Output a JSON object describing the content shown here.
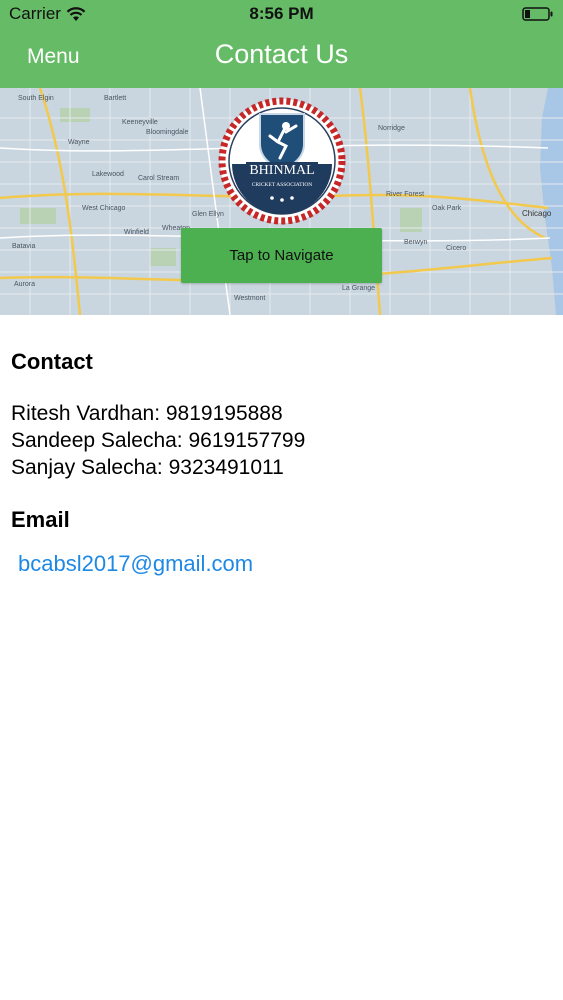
{
  "status_bar": {
    "carrier": "Carrier",
    "time": "8:56 PM"
  },
  "nav": {
    "menu_label": "Menu",
    "title": "Contact Us"
  },
  "map": {
    "places": [
      "South Elgin",
      "Bartlett",
      "Keeneyville",
      "Bloomingdale",
      "Wayne",
      "Carol Stream",
      "Lakewood",
      "Glen Ellyn",
      "Wheaton",
      "West Chicago",
      "Winfield",
      "Batavia",
      "Aurora",
      "Oak Park",
      "Chicago",
      "Cicero",
      "Berwyn",
      "River Forest",
      "Norridge",
      "Westmont",
      "La Grange"
    ],
    "logo_text": "BHINMAL",
    "logo_subtext": "CRICKET ASSOCIATION",
    "navigate_label": "Tap to Navigate"
  },
  "contact": {
    "heading": "Contact",
    "lines": [
      "Ritesh Vardhan: 9819195888",
      "Sandeep Salecha: 9619157799",
      "Sanjay Salecha: 9323491011"
    ]
  },
  "email": {
    "heading": "Email",
    "address": "bcabsl2017@gmail.com"
  },
  "colors": {
    "header_bg": "#66bb66",
    "button_bg": "#4caf50",
    "link": "#1e88e5",
    "map_water": "#a8c6e6"
  }
}
